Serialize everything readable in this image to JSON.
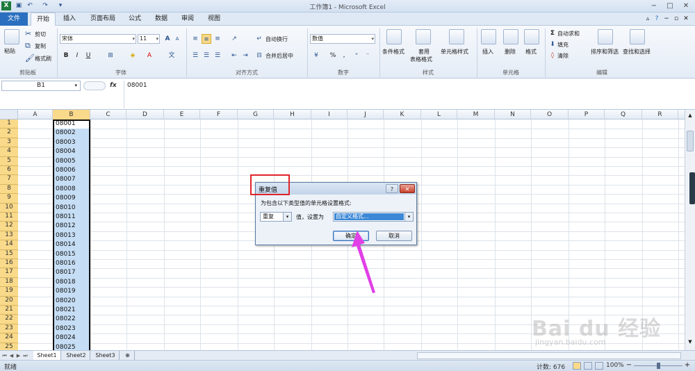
{
  "window": {
    "title": "工作簿1 - Microsoft Excel",
    "controls": [
      "−",
      "□",
      "✕"
    ]
  },
  "tabs": [
    {
      "label": "文件"
    },
    {
      "label": "开始"
    },
    {
      "label": "插入"
    },
    {
      "label": "页面布局"
    },
    {
      "label": "公式"
    },
    {
      "label": "数据"
    },
    {
      "label": "审阅"
    },
    {
      "label": "视图"
    }
  ],
  "ribbon": {
    "clipboard": {
      "paste": "粘贴",
      "cut": "剪切",
      "copy": "复制",
      "format_painter": "格式刷",
      "label": "剪贴板"
    },
    "font": {
      "name": "宋体",
      "size": "11",
      "label": "字体",
      "bold": "B",
      "italic": "I",
      "underline": "U",
      "grow": "A",
      "shrink": "A"
    },
    "alignment": {
      "wrap": "自动换行",
      "merge": "合并后居中",
      "label": "对齐方式"
    },
    "number": {
      "format": "数值",
      "percent": "%",
      "comma": ",",
      "label": "数字"
    },
    "styles": {
      "conditional": "条件格式",
      "table": "套用\n表格格式",
      "table_l1": "套用",
      "table_l2": "表格格式",
      "cell_style": "单元格样式",
      "label": "样式"
    },
    "cells": {
      "insert": "插入",
      "delete": "删除",
      "format": "格式",
      "label": "单元格"
    },
    "editing": {
      "autosum": "自动求和",
      "fill": "填充",
      "clear": "清除",
      "sort": "排序和筛选",
      "find": "查找和选择",
      "label": "编辑"
    }
  },
  "formula_bar": {
    "name_box": "B1",
    "fx": "fx",
    "value": "08001"
  },
  "columns": [
    "A",
    "B",
    "C",
    "D",
    "E",
    "F",
    "G",
    "H",
    "I",
    "J",
    "K",
    "L",
    "M",
    "N",
    "O",
    "P",
    "Q",
    "R"
  ],
  "rows": [
    "1",
    "2",
    "3",
    "4",
    "5",
    "6",
    "7",
    "8",
    "9",
    "10",
    "11",
    "12",
    "13",
    "14",
    "15",
    "16",
    "17",
    "18",
    "19",
    "20",
    "21",
    "22",
    "23",
    "24",
    "25"
  ],
  "col_b_values": [
    "08001",
    "08002",
    "08003",
    "08004",
    "08005",
    "08006",
    "08007",
    "08008",
    "08009",
    "08010",
    "08011",
    "08012",
    "08013",
    "08014",
    "08015",
    "08016",
    "08017",
    "08018",
    "08019",
    "08020",
    "08021",
    "08022",
    "08023",
    "08024",
    "08025"
  ],
  "sheets": [
    "Sheet1",
    "Sheet2",
    "Sheet3"
  ],
  "status": {
    "ready": "就绪",
    "count": "计数: 676",
    "zoom": "100%"
  },
  "dialog": {
    "title": "重复值",
    "description": "为包含以下类型值的单元格设置格式:",
    "type_value": "重复",
    "middle_text": "值，设置为",
    "format_value": "自定义格式...",
    "ok": "确定",
    "cancel": "取消",
    "help": "?",
    "close": "✕"
  },
  "watermark": {
    "main": "Bai du 经验",
    "sub": "jingyan.baidu.com"
  },
  "colors": {
    "accent": "#2a6fbf",
    "selection": "#c6def5",
    "header_selected": "#f9d98a",
    "annotation": "#e0242a",
    "arrow": "#e040e6"
  }
}
